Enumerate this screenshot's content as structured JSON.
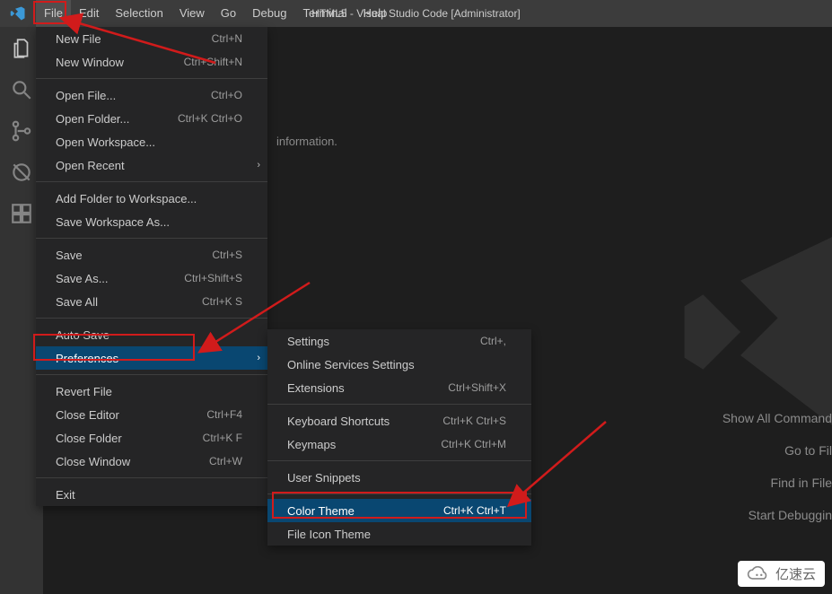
{
  "menubar": {
    "items": [
      "File",
      "Edit",
      "Selection",
      "View",
      "Go",
      "Debug",
      "Terminal",
      "Help"
    ]
  },
  "window_title": "HTML5 - Visual Studio Code [Administrator]",
  "info": "information.",
  "shortcuts": {
    "0": "Show All Command",
    "1": "Go to Fil",
    "2": "Find in File",
    "3": "Start Debuggin"
  },
  "file_menu": {
    "g0": [
      {
        "label": "New File",
        "kb": "Ctrl+N"
      },
      {
        "label": "New Window",
        "kb": "Ctrl+Shift+N"
      }
    ],
    "g1": [
      {
        "label": "Open File...",
        "kb": "Ctrl+O"
      },
      {
        "label": "Open Folder...",
        "kb": "Ctrl+K Ctrl+O"
      },
      {
        "label": "Open Workspace...",
        "kb": ""
      },
      {
        "label": "Open Recent",
        "kb": "",
        "sub": true
      }
    ],
    "g2": [
      {
        "label": "Add Folder to Workspace...",
        "kb": ""
      },
      {
        "label": "Save Workspace As...",
        "kb": ""
      }
    ],
    "g3": [
      {
        "label": "Save",
        "kb": "Ctrl+S"
      },
      {
        "label": "Save As...",
        "kb": "Ctrl+Shift+S"
      },
      {
        "label": "Save All",
        "kb": "Ctrl+K S"
      }
    ],
    "g4": [
      {
        "label": "Auto Save",
        "kb": ""
      },
      {
        "label": "Preferences",
        "kb": "",
        "sub": true,
        "hl": true
      }
    ],
    "g5": [
      {
        "label": "Revert File",
        "kb": ""
      },
      {
        "label": "Close Editor",
        "kb": "Ctrl+F4"
      },
      {
        "label": "Close Folder",
        "kb": "Ctrl+K F"
      },
      {
        "label": "Close Window",
        "kb": "Ctrl+W"
      }
    ],
    "g6": [
      {
        "label": "Exit",
        "kb": ""
      }
    ]
  },
  "pref_menu": {
    "g0": [
      {
        "label": "Settings",
        "kb": "Ctrl+,"
      },
      {
        "label": "Online Services Settings",
        "kb": ""
      },
      {
        "label": "Extensions",
        "kb": "Ctrl+Shift+X"
      }
    ],
    "g1": [
      {
        "label": "Keyboard Shortcuts",
        "kb": "Ctrl+K Ctrl+S"
      },
      {
        "label": "Keymaps",
        "kb": "Ctrl+K Ctrl+M"
      }
    ],
    "g2": [
      {
        "label": "User Snippets",
        "kb": ""
      }
    ],
    "g3": [
      {
        "label": "Color Theme",
        "kb": "Ctrl+K Ctrl+T",
        "hl": true
      },
      {
        "label": "File Icon Theme",
        "kb": ""
      }
    ]
  },
  "brand": "亿速云",
  "activity_icons": [
    "files-icon",
    "search-icon",
    "source-control-icon",
    "debug-alt-icon",
    "extensions-icon"
  ]
}
